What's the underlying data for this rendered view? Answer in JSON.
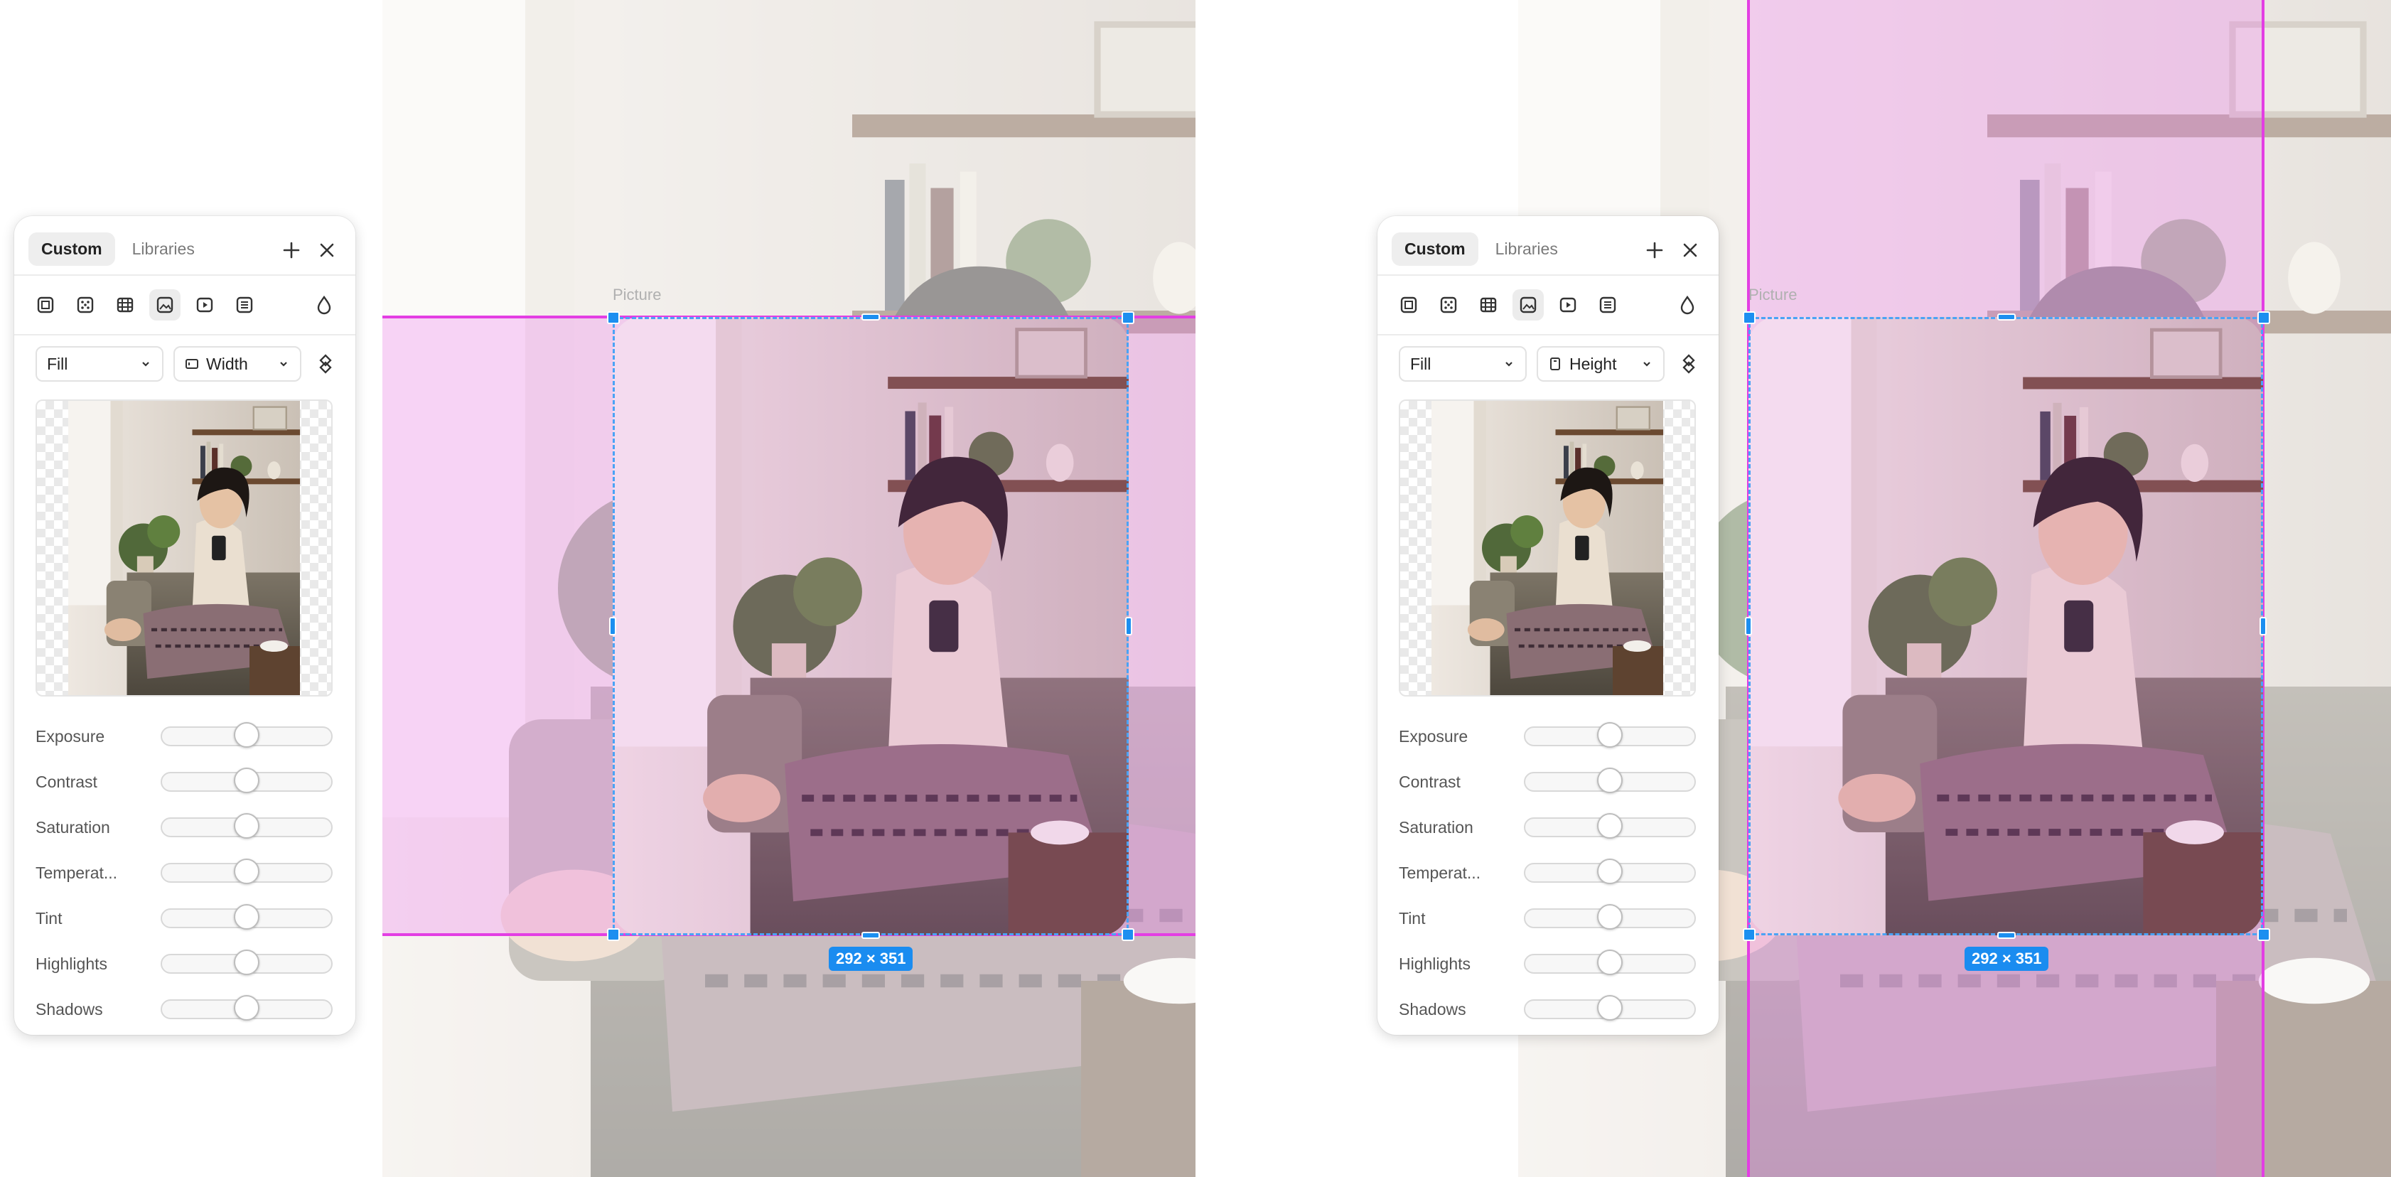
{
  "colors": {
    "accent_blue": "#1a8cf0",
    "guide_magenta": "#e33ee3",
    "fill_overlay": "rgba(236,110,236,0.28)"
  },
  "canvas": {
    "frame_label": "Picture",
    "size_badge": "292 × 351"
  },
  "panels": [
    {
      "tabs": [
        "Custom",
        "Libraries"
      ],
      "active_tab": "Custom",
      "actions": [
        "plus-icon",
        "close-icon"
      ],
      "tools": [
        "frame-tool-icon",
        "dither-tool-icon",
        "film-tool-icon",
        "image-tool-icon",
        "video-tool-icon",
        "text-lines-tool-icon",
        "drop-icon"
      ],
      "active_tool": "image-tool-icon",
      "fill_select": "Fill",
      "fit_select": "Width",
      "fit_icon": "width-frame-icon",
      "adjustments": [
        {
          "label": "Exposure",
          "value": 0.5
        },
        {
          "label": "Contrast",
          "value": 0.5
        },
        {
          "label": "Saturation",
          "value": 0.5
        },
        {
          "label": "Temperat...",
          "value": 0.5
        },
        {
          "label": "Tint",
          "value": 0.5
        },
        {
          "label": "Highlights",
          "value": 0.5
        },
        {
          "label": "Shadows",
          "value": 0.5
        }
      ]
    },
    {
      "tabs": [
        "Custom",
        "Libraries"
      ],
      "active_tab": "Custom",
      "actions": [
        "plus-icon",
        "close-icon"
      ],
      "tools": [
        "frame-tool-icon",
        "dither-tool-icon",
        "film-tool-icon",
        "image-tool-icon",
        "video-tool-icon",
        "text-lines-tool-icon",
        "drop-icon"
      ],
      "active_tool": "image-tool-icon",
      "fill_select": "Fill",
      "fit_select": "Height",
      "fit_icon": "height-frame-icon",
      "adjustments": [
        {
          "label": "Exposure",
          "value": 0.5
        },
        {
          "label": "Contrast",
          "value": 0.5
        },
        {
          "label": "Saturation",
          "value": 0.5
        },
        {
          "label": "Temperat...",
          "value": 0.5
        },
        {
          "label": "Tint",
          "value": 0.5
        },
        {
          "label": "Highlights",
          "value": 0.5
        },
        {
          "label": "Shadows",
          "value": 0.5
        }
      ]
    }
  ]
}
